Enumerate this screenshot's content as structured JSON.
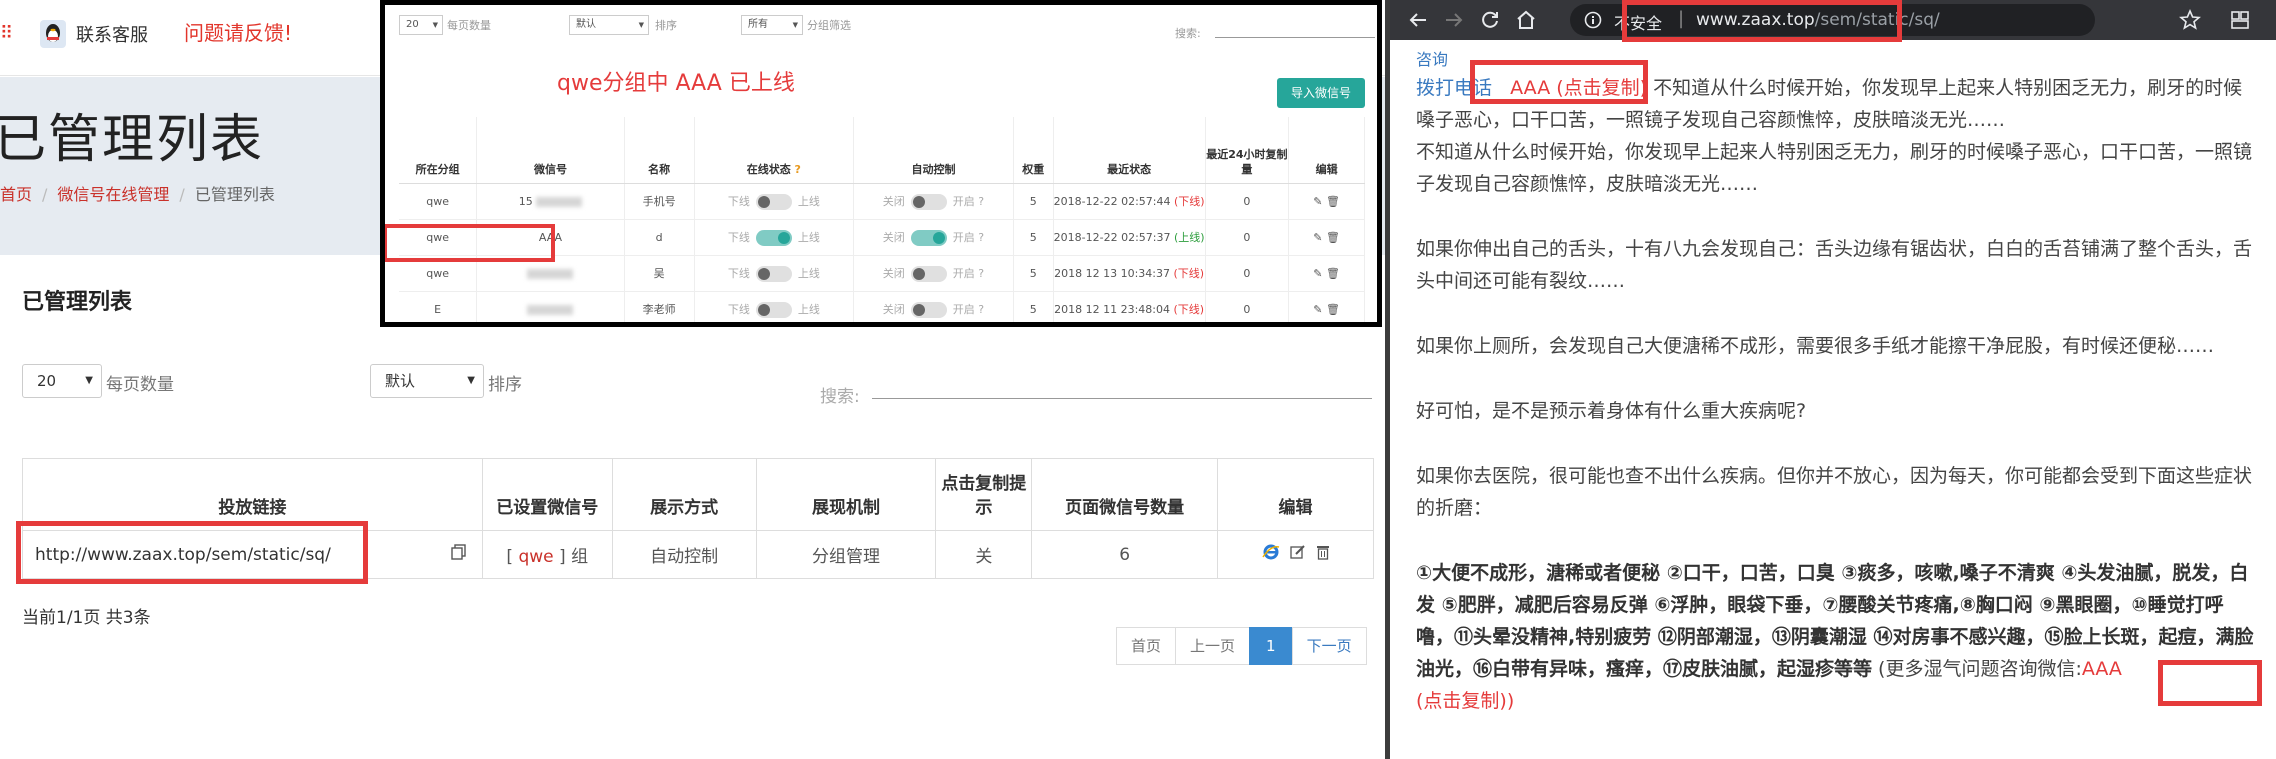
{
  "left": {
    "topbar": {
      "menu_glyph": "⠿",
      "support_label": "联系客服",
      "feedback_label": "问题请反馈!"
    },
    "page_title": "已管理列表",
    "breadcrumb": [
      "首页",
      "微信号在线管理",
      "已管理列表"
    ],
    "panel_title": "已管理列表",
    "per_page_value": "20",
    "per_page_label": "每页数量",
    "sort_value": "默认",
    "sort_label": "排序",
    "search_label": "搜索:",
    "table": {
      "headers": [
        "投放链接",
        "已设置微信号",
        "展示方式",
        "展现机制",
        "点击复制提示",
        "页面微信号数量",
        "编辑"
      ],
      "rows": [
        {
          "link": "http://www.zaax.top/sem/static/sq/",
          "wechat_bracket_open": "[",
          "wechat_group": "qwe",
          "wechat_bracket_close": "] 组",
          "display_mode": "自动控制",
          "mechanism": "分组管理",
          "copy_hint": "关",
          "count": "6"
        }
      ]
    },
    "page_info": "当前1/1页 共3条",
    "pager": {
      "first": "首页",
      "prev": "上一页",
      "current": "1",
      "next": "下一页"
    },
    "accent_color": "#c9312a"
  },
  "inset": {
    "per_page_value": "20",
    "per_page_label": "每页数量",
    "sort_value": "默认",
    "sort_label": "排序",
    "filter_value": "所有",
    "filter_label": "分组筛选",
    "search_label": "搜索:",
    "online_message": "qwe分组中 AAA 已上线",
    "import_button": "导入微信号",
    "headers": [
      "所在分组",
      "微信号",
      "名称",
      "在线状态",
      "自动控制",
      "权重",
      "最近状态",
      "最近24小时复制量",
      "编辑"
    ],
    "online_off": "下线",
    "online_on": "上线",
    "auto_off": "关闭",
    "auto_on": "开启",
    "rows": [
      {
        "group": "qwe",
        "wechat": "15",
        "name": "手机号",
        "online": false,
        "auto": false,
        "weight": "5",
        "status_time": "2018-12-22 02:57:44",
        "status_tag": "(下线)",
        "copies": "0"
      },
      {
        "group": "qwe",
        "wechat": "AAA",
        "name": "d",
        "online": true,
        "auto": true,
        "weight": "5",
        "status_time": "2018-12-22 02:57:37",
        "status_tag": "(上线)",
        "copies": "0"
      },
      {
        "group": "qwe",
        "wechat": "",
        "name": "吴",
        "online": false,
        "auto": false,
        "weight": "5",
        "status_time": "2018 12 13 10:34:37",
        "status_tag": "(下线)",
        "copies": "0"
      },
      {
        "group": "E",
        "wechat": "",
        "name": "李老师",
        "online": false,
        "auto": false,
        "weight": "5",
        "status_time": "2018 12 11 23:48:04",
        "status_tag": "(下线)",
        "copies": "0"
      }
    ]
  },
  "browser": {
    "insecure_label": "不安全",
    "url_host": "www.zaax.top",
    "url_path": "/sem/static/sq/",
    "top_cut_text": "咨询",
    "article": {
      "call_label": "拨打电话",
      "aaa_copy": "AAA (点击复制)",
      "p1_rest": " 不知道从什么时候开始，你发现早上起来人特别困乏无力，刷牙的时候嗓子恶心，口干口苦，一照镜子发现自己容颜憔悴，皮肤暗淡无光……",
      "p1_line2": "不知道从什么时候开始，你发现早上起来人特别困乏无力，刷牙的时候嗓子恶心，口干口苦，一照镜子发现自己容颜憔悴，皮肤暗淡无光……",
      "p2": "如果你伸出自己的舌头，十有八九会发现自己：舌头边缘有锯齿状，白白的舌苔铺满了整个舌头，舌头中间还可能有裂纹……",
      "p3": "如果你上厕所，会发现自己大便溏稀不成形，需要很多手纸才能擦干净屁股，有时候还便秘……",
      "p4": "好可怕，是不是预示着身体有什么重大疾病呢?",
      "p5": "如果你去医院，很可能也查不出什么疾病。但你并不放心，因为每天，你可能都会受到下面这些症状的折磨：",
      "symptoms": "①大便不成形，溏稀或者便秘 ②口干，口苦，口臭 ③痰多，咳嗽,嗓子不清爽 ④头发油腻，脱发，白发 ⑤肥胖，减肥后容易反弹 ⑥浮肿，眼袋下垂，⑦腰酸关节疼痛,⑧胸口闷 ⑨黑眼圈，⑩睡觉打呼噜，⑪头晕没精神,特别疲劳 ⑫阴部潮湿，⑬阴囊潮湿 ⑭对房事不感兴趣，⑮脸上长斑，起痘，满脸油光，⑯白带有异味，瘙痒，⑰皮肤油腻，起湿疹等等",
      "consult_prefix": " (更多湿气问题咨询微信:",
      "consult_aaa": "AAA",
      "consult_copy": "(点击复制)",
      "consult_suffix": ")"
    }
  },
  "colors": {
    "highlight_box": "#e53b3b",
    "link_blue": "#3a7ac0",
    "toggle_on": "#26a69a"
  }
}
